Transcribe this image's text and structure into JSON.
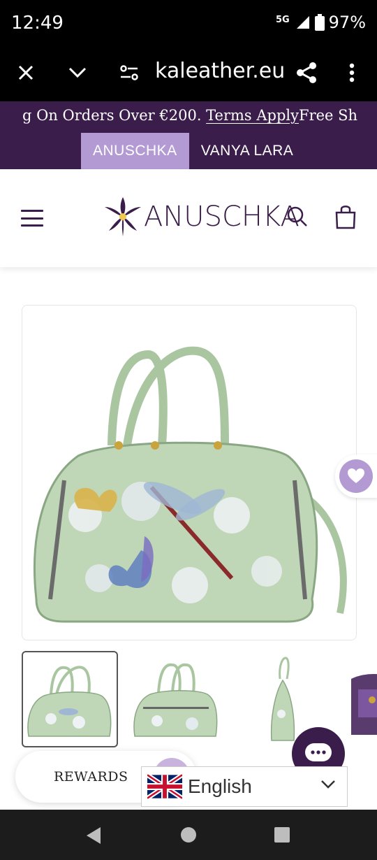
{
  "status": {
    "time": "12:49",
    "network": "5G",
    "battery": "97%"
  },
  "browser": {
    "url": "kaleather.eu",
    "icons": [
      "close-icon",
      "chevron-down-icon",
      "site-settings-icon",
      "share-icon",
      "more-vert-icon"
    ]
  },
  "promo": {
    "text_before": "g On Orders Over €200. ",
    "link": "Terms Apply",
    "text_after": "Free Shipping"
  },
  "brand_tabs": [
    {
      "label": "ANUSCHKA",
      "active": true
    },
    {
      "label": "VANYA LARA",
      "active": false
    }
  ],
  "header": {
    "logo_text": "ANUSCHKA",
    "icons": [
      "menu-icon",
      "search-icon",
      "bag-icon"
    ]
  },
  "product": {
    "thumbnail_count": 4,
    "wishlist_icon": "heart-icon"
  },
  "rewards": {
    "label": "REWARDS"
  },
  "language": {
    "label": "English",
    "flag": "uk-flag-icon"
  },
  "colors": {
    "brand_purple": "#3a1d4a",
    "lavender": "#b39ad3",
    "bag_green": "#b5cfae"
  }
}
